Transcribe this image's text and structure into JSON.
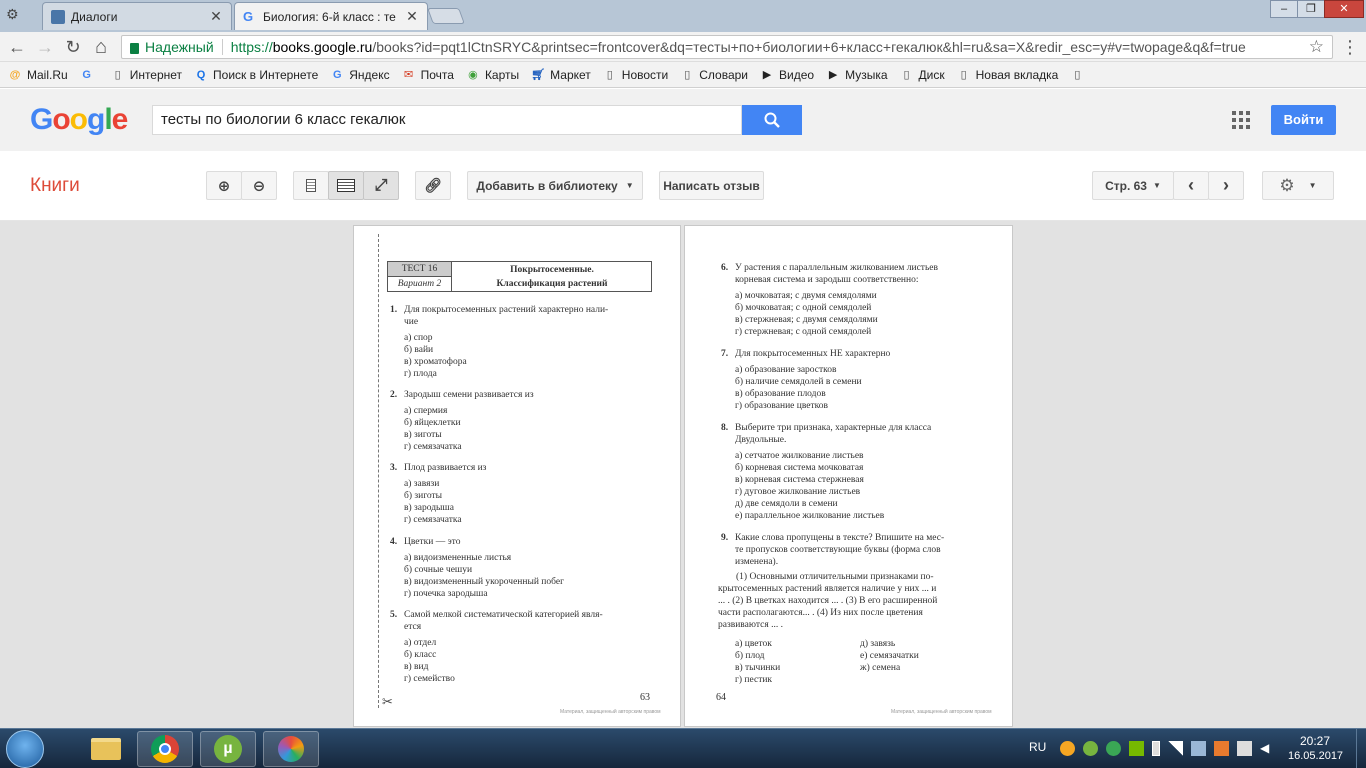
{
  "browser": {
    "tabs": [
      {
        "title": "Диалоги",
        "active": false,
        "favicon_color": "#4a76a8"
      },
      {
        "title": "Биология: 6-й класс : те",
        "active": true,
        "favicon_color": "#4285f4"
      }
    ],
    "window_controls": {
      "minimize": "–",
      "restore": "❐",
      "close": "✕"
    },
    "nav": {
      "back": "←",
      "forward": "→",
      "reload": "↻",
      "home": "⌂"
    },
    "secure_label": "Надежный",
    "url_scheme": "https://",
    "url_host": "books.google.ru",
    "url_path": "/books?id=pqt1lCtnSRYC&printsec=frontcover&dq=тесты+по+биологии+6+класс+гекалюк&hl=ru&sa=X&redir_esc=y#v=twopage&q&f=true",
    "bookmarks": [
      {
        "label": "Mail.Ru",
        "icon": "at-icon"
      },
      {
        "label": "",
        "icon": "google-icon"
      },
      {
        "label": "Интернет",
        "icon": "page-icon"
      },
      {
        "label": "Поиск в Интернете",
        "icon": "search-icon"
      },
      {
        "label": "Яндекс",
        "icon": "google-icon"
      },
      {
        "label": "Почта",
        "icon": "envelope-icon"
      },
      {
        "label": "Карты",
        "icon": "map-icon"
      },
      {
        "label": "Маркет",
        "icon": "cart-icon"
      },
      {
        "label": "Новости",
        "icon": "page-icon"
      },
      {
        "label": "Словари",
        "icon": "page-icon"
      },
      {
        "label": "Видео",
        "icon": "play-icon"
      },
      {
        "label": "Музыка",
        "icon": "play-icon"
      },
      {
        "label": "Диск",
        "icon": "page-icon"
      },
      {
        "label": "Новая вкладка",
        "icon": "page-icon"
      },
      {
        "label": "",
        "icon": "page-icon"
      }
    ]
  },
  "google": {
    "logo": [
      "G",
      "o",
      "o",
      "g",
      "l",
      "e"
    ],
    "logo_colors": [
      "#4285f4",
      "#ea4335",
      "#fbbc05",
      "#4285f4",
      "#34a853",
      "#ea4335"
    ],
    "search_query": "тесты по биологии 6 класс гекалюк",
    "signin_label": "Войти"
  },
  "books": {
    "section_title": "Книги",
    "add_to_library": "Добавить в библиотеку",
    "write_review": "Написать отзыв",
    "page_label": "Стр. 63"
  },
  "left_page": {
    "header": {
      "test": "ТЕСТ 16",
      "variant": "Вариант 2",
      "title_line1": "Покрытосеменные.",
      "title_line2": "Классификация растений"
    },
    "questions": [
      {
        "num": "1.",
        "text": [
          "Для покрытосеменных растений характерно нали-",
          "чие"
        ],
        "options": [
          "а) спор",
          "б) вайи",
          "в) хроматофора",
          "г) плода"
        ]
      },
      {
        "num": "2.",
        "text": [
          "Зародыш семени развивается из"
        ],
        "options": [
          "а) спермия",
          "б) яйцеклетки",
          "в) зиготы",
          "г) семязачатка"
        ]
      },
      {
        "num": "3.",
        "text": [
          "Плод развивается из"
        ],
        "options": [
          "а) завязи",
          "б) зиготы",
          "в) зародыша",
          "г) семязачатка"
        ]
      },
      {
        "num": "4.",
        "text": [
          "Цветки — это"
        ],
        "options": [
          "а) видоизмененные листья",
          "б) сочные чешуи",
          "в) видоизмененный укороченный побег",
          "г) почечка зародыша"
        ]
      },
      {
        "num": "5.",
        "text": [
          "Самой мелкой систематической категорией явля-",
          "ется"
        ],
        "options": [
          "а) отдел",
          "б) класс",
          "в) вид",
          "г) семейство"
        ]
      }
    ],
    "page_number": "63",
    "credit": "Материал, защищенный авторским правом"
  },
  "right_page": {
    "questions": [
      {
        "num": "6.",
        "text": [
          "У растения с параллельным жилкованием листьев",
          "корневая система и зародыш соответственно:"
        ],
        "options": [
          "а) мочковатая; с двумя семядолями",
          "б) мочковатая; с одной семядолей",
          "в) стержневая; с двумя семядолями",
          "г) стержневая; с одной семядолей"
        ]
      },
      {
        "num": "7.",
        "text": [
          "Для покрытосеменных НЕ характерно"
        ],
        "options": [
          "а) образование заростков",
          "б) наличие семядолей в семени",
          "в) образование плодов",
          "г) образование цветков"
        ]
      },
      {
        "num": "8.",
        "text": [
          "Выберите три признака, характерные для класса",
          "Двудольные."
        ],
        "options": [
          "а) сетчатое жилкование листьев",
          "б) корневая система мочковатая",
          "в) корневая система стержневая",
          "г) дуговое жилкование листьев",
          "д) две семядоли в семени",
          "е) параллельное жилкование листьев"
        ]
      },
      {
        "num": "9.",
        "text": [
          "Какие слова пропущены в тексте? Впишите на мес-",
          "те пропусков соответствующие буквы (форма слов",
          "изменена)."
        ],
        "options": []
      }
    ],
    "passage": [
      "(1) Основными отличительными признаками по-",
      "крытосеменных растений является наличие у них ... и",
      "... . (2) В цветках находится ... . (3) В его расширенной",
      "части располагаются... . (4) Из них после цветения",
      "развиваются ... ."
    ],
    "answers_left": [
      "а) цветок",
      "б) плод",
      "в) тычинки",
      "г) пестик"
    ],
    "answers_right": [
      "д) завязь",
      "е) семязачатки",
      "ж) семена"
    ],
    "page_number": "64",
    "credit": "Материал, защищенный авторским правом"
  },
  "taskbar": {
    "lang": "RU",
    "time": "20:27",
    "date": "16.05.2017"
  }
}
